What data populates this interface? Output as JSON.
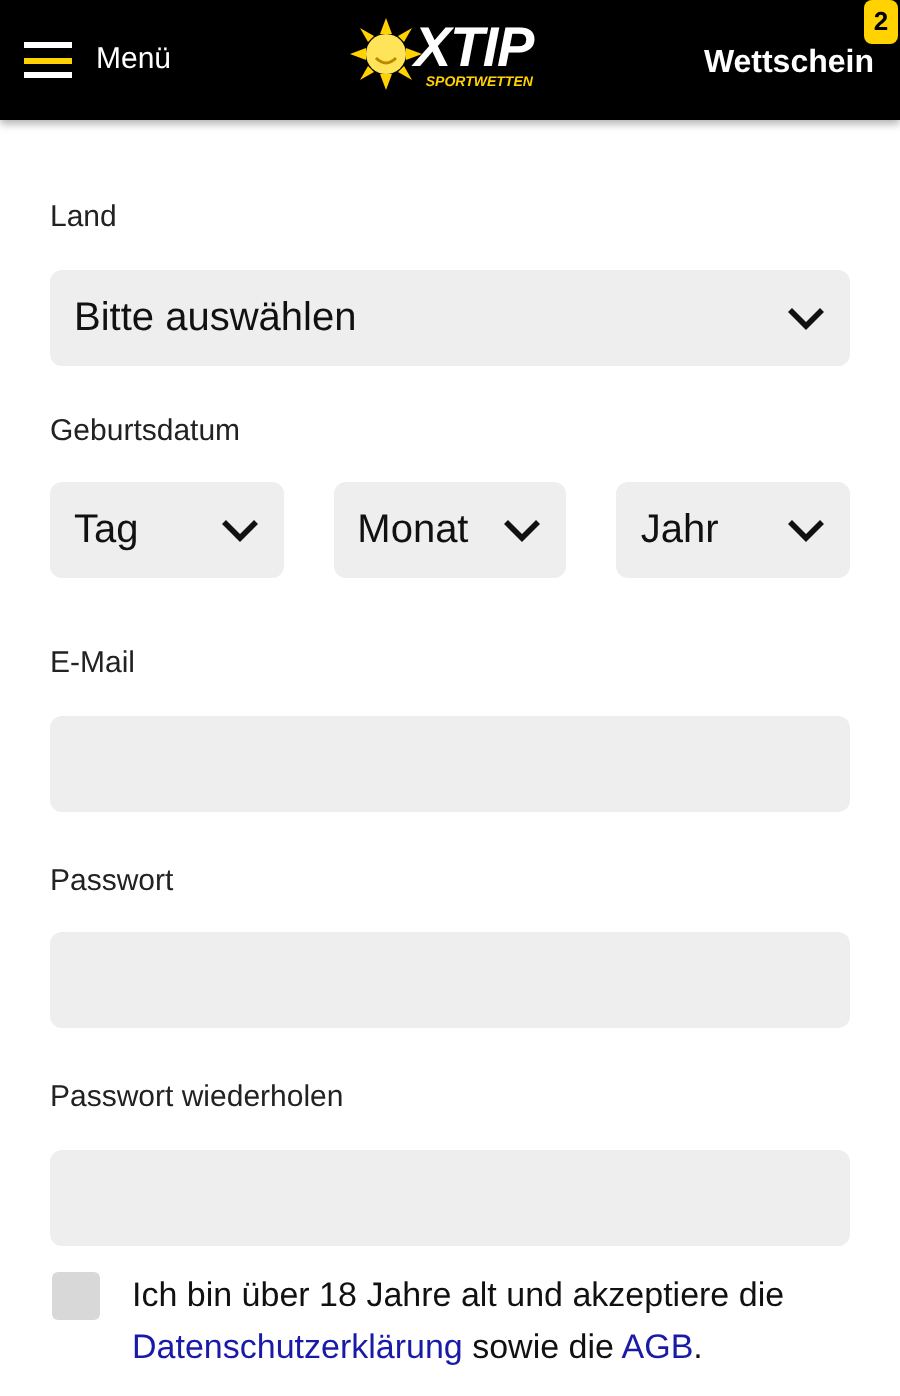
{
  "header": {
    "menu_label": "Menü",
    "logo": {
      "wordmark": "XTIP",
      "tagline": "SPORTWETTEN"
    },
    "betslip": {
      "label": "Wettschein",
      "count": "2"
    }
  },
  "form": {
    "country": {
      "label": "Land",
      "value": "Bitte auswählen"
    },
    "birthdate": {
      "label": "Geburtsdatum",
      "selects": [
        {
          "value": "Tag"
        },
        {
          "value": "Monat"
        },
        {
          "value": "Jahr"
        }
      ]
    },
    "fields": [
      {
        "label": "E-Mail"
      },
      {
        "label": "Passwort"
      },
      {
        "label": "Passwort wiederholen"
      }
    ],
    "consent": {
      "checked": false,
      "parts": [
        {
          "kind": "text",
          "text": "Ich bin über 18 Jahre alt und akzeptiere die "
        },
        {
          "kind": "link",
          "text": "Datenschutzerklärung"
        },
        {
          "kind": "text",
          "text": " sowie die "
        },
        {
          "kind": "link",
          "text": "AGB"
        },
        {
          "kind": "text",
          "text": "."
        }
      ]
    }
  }
}
